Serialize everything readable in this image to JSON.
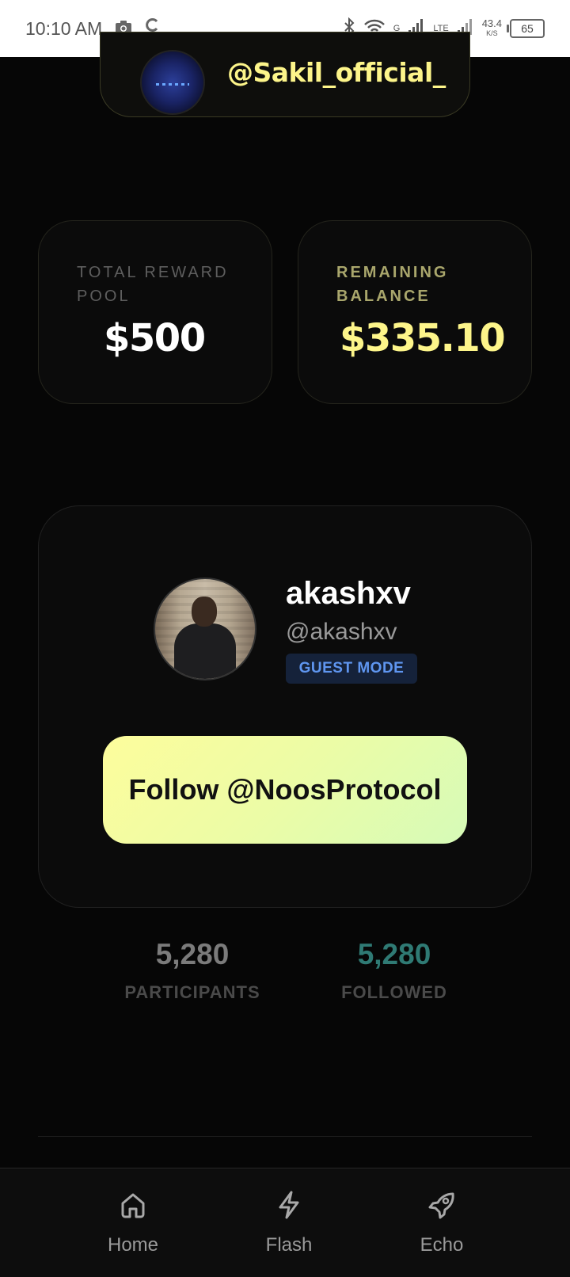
{
  "status_bar": {
    "time": "10:10 AM",
    "network_label": "G",
    "network_label_2": "LTE",
    "speed_value": "43.4",
    "speed_unit": "K/S",
    "battery": "65"
  },
  "campaign": {
    "handle": "@Sakil_official_"
  },
  "stats": {
    "total_pool_label": "TOTAL REWARD POOL",
    "total_pool_value": "$500",
    "remaining_label": "REMAINING BALANCE",
    "remaining_value": "$335.10"
  },
  "user": {
    "name": "akashxv",
    "handle": "@akashxv",
    "badge": "GUEST MODE"
  },
  "follow_button": {
    "label": "Follow @NoosProtocol"
  },
  "counters": {
    "participants_value": "5,280",
    "participants_label": "PARTICIPANTS",
    "followed_value": "5,280",
    "followed_label": "FOLLOWED"
  },
  "nav": {
    "items": [
      {
        "label": "Home",
        "icon": "home-icon"
      },
      {
        "label": "Flash",
        "icon": "lightning-icon"
      },
      {
        "label": "Echo",
        "icon": "rocket-icon"
      }
    ]
  },
  "colors": {
    "accent_yellow": "#fdf58a",
    "guest_badge_text": "#5f96f0",
    "followed_teal": "#2f7a74",
    "background": "#060606"
  }
}
